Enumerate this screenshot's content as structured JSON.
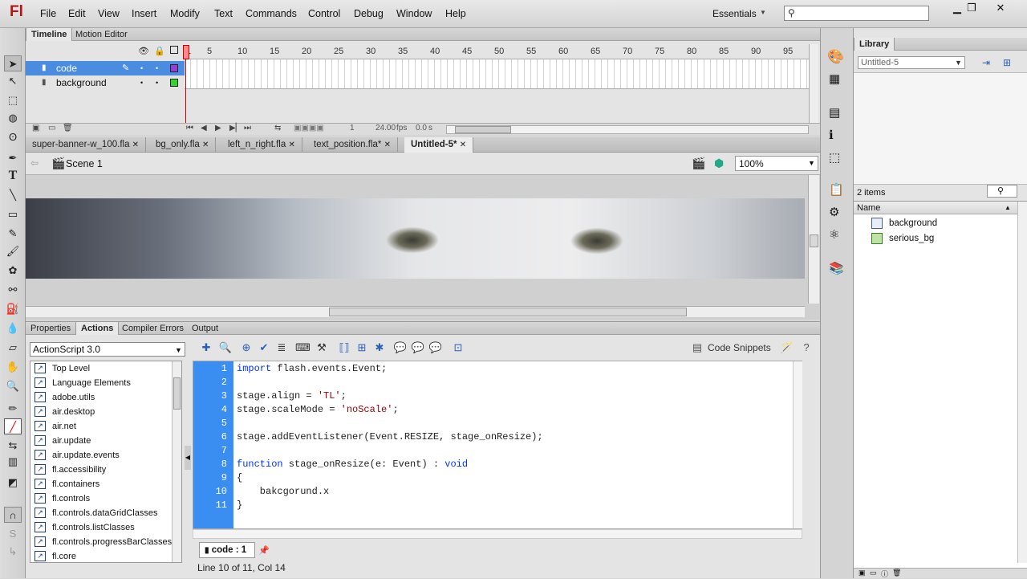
{
  "app": {
    "logo": "Fl"
  },
  "menu": [
    "File",
    "Edit",
    "View",
    "Insert",
    "Modify",
    "Text",
    "Commands",
    "Control",
    "Debug",
    "Window",
    "Help"
  ],
  "workspace": {
    "label": "Essentials"
  },
  "timeline": {
    "tabs": [
      "Timeline",
      "Motion Editor"
    ],
    "layers": [
      {
        "name": "code",
        "color": "#9c3cd8"
      },
      {
        "name": "background",
        "color": "#2fd82f"
      }
    ],
    "ruler": [
      "1",
      "5",
      "10",
      "15",
      "20",
      "25",
      "30",
      "35",
      "40",
      "45",
      "50",
      "55",
      "60",
      "65",
      "70",
      "75",
      "80",
      "85",
      "90",
      "95"
    ],
    "frame": "1",
    "fps": "24.00",
    "fps_unit": "fps",
    "time": "0.0",
    "time_unit": "s"
  },
  "documents": [
    "super-banner-w_100.fla",
    "bg_only.fla",
    "left_n_right.fla",
    "text_position.fla*",
    "Untitled-5*"
  ],
  "scene": {
    "label": "Scene 1",
    "zoom": "100%"
  },
  "bottom_panel": {
    "tabs": [
      "Properties",
      "Actions",
      "Compiler Errors",
      "Output"
    ],
    "as_version": "ActionScript 3.0",
    "tree": [
      "Top Level",
      "Language Elements",
      "adobe.utils",
      "air.desktop",
      "air.net",
      "air.update",
      "air.update.events",
      "fl.accessibility",
      "fl.containers",
      "fl.controls",
      "fl.controls.dataGridClasses",
      "fl.controls.listClasses",
      "fl.controls.progressBarClasses",
      "fl.core"
    ],
    "code_snippets": "Code Snippets",
    "code_tab": "code : 1",
    "status": "Line 10 of 11, Col 14"
  },
  "code_lines": [
    {
      "n": "1",
      "segments": [
        {
          "t": "import",
          "c": "kw"
        },
        {
          "t": " flash.events.Event;",
          "c": ""
        }
      ]
    },
    {
      "n": "2",
      "segments": []
    },
    {
      "n": "3",
      "segments": [
        {
          "t": "stage.align = ",
          "c": ""
        },
        {
          "t": "'TL'",
          "c": "str"
        },
        {
          "t": ";",
          "c": ""
        }
      ]
    },
    {
      "n": "4",
      "segments": [
        {
          "t": "stage.scaleMode = ",
          "c": ""
        },
        {
          "t": "'noScale'",
          "c": "str"
        },
        {
          "t": ";",
          "c": ""
        }
      ]
    },
    {
      "n": "5",
      "segments": []
    },
    {
      "n": "6",
      "segments": [
        {
          "t": "stage.addEventListener(Event.RESIZE, stage_onResize);",
          "c": ""
        }
      ]
    },
    {
      "n": "7",
      "segments": []
    },
    {
      "n": "8",
      "segments": [
        {
          "t": "function",
          "c": "kw"
        },
        {
          "t": " stage_onResize(e: Event) : ",
          "c": ""
        },
        {
          "t": "void",
          "c": "kw"
        }
      ]
    },
    {
      "n": "9",
      "segments": [
        {
          "t": "{",
          "c": ""
        }
      ]
    },
    {
      "n": "10",
      "segments": [
        {
          "t": "    bakcgorund.x",
          "c": ""
        }
      ]
    },
    {
      "n": "11",
      "segments": [
        {
          "t": "}",
          "c": ""
        }
      ]
    }
  ],
  "library": {
    "title": "Library",
    "doc": "Untitled-5",
    "count": "2 items",
    "column": "Name",
    "items": [
      "background",
      "serious_bg"
    ]
  },
  "colors": {
    "gutter": "#3a8ef2",
    "keyword": "#0033ff",
    "string": "#990000"
  }
}
